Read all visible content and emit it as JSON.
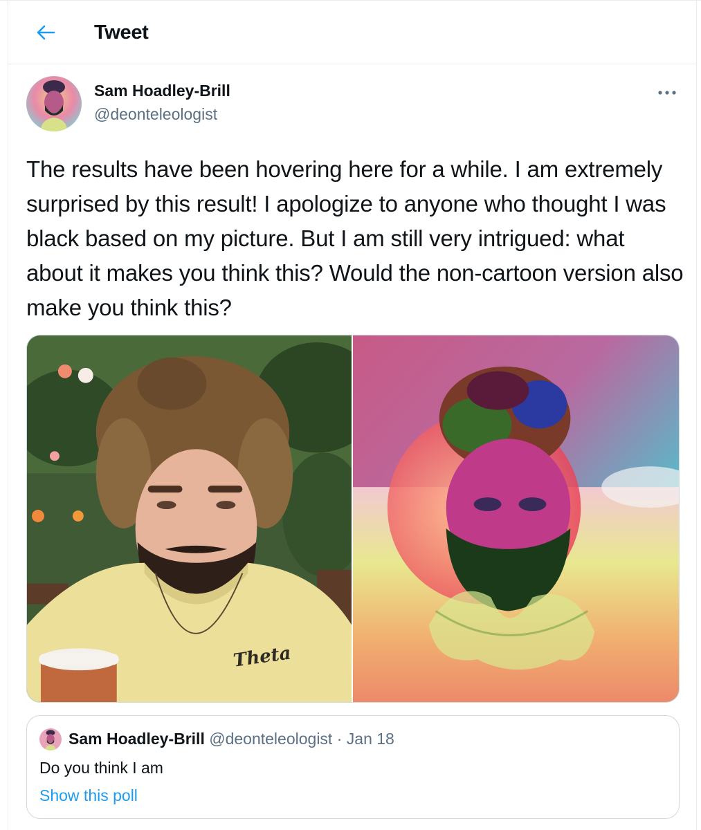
{
  "header": {
    "title": "Tweet",
    "back_icon": "arrow-left-icon",
    "accent_color": "#1d9bf0"
  },
  "tweet": {
    "author": {
      "name": "Sam Hoadley-Brill",
      "handle": "@deonteleologist"
    },
    "more_icon": "more-dots-icon",
    "text": "The results have been hovering here for a while. I am extremely surprised by this result! I apologize to anyone who thought I was black based on my picture. But I am still very intrigued: what about it makes you think this? Would the non-cartoon version also make you think this?",
    "media": {
      "shirt_text": "Theta"
    },
    "quoted": {
      "name": "Sam Hoadley-Brill",
      "handle": "@deonteleologist",
      "separator": "·",
      "date": "Jan 18",
      "text": "Do you think I am",
      "link": "Show this poll"
    }
  }
}
